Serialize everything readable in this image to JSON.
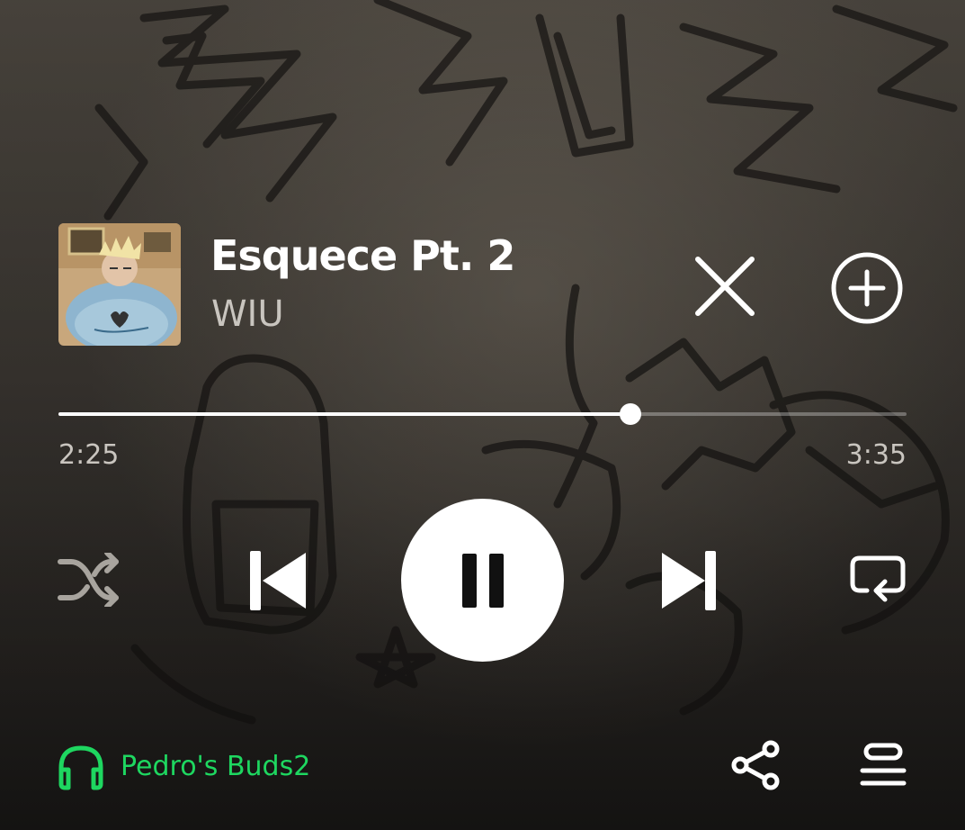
{
  "track": {
    "title": "Esquece Pt. 2",
    "artist": "WIU"
  },
  "playback": {
    "current_time": "2:25",
    "total_time": "3:35",
    "progress_fraction": 0.674,
    "is_playing": true
  },
  "device": {
    "name": "Pedro's Buds2"
  },
  "colors": {
    "accent": "#1ed760",
    "primary_text": "#ffffff",
    "secondary_text": "#c9c5bf"
  },
  "icons": {
    "close": "close-icon",
    "add": "add-circle-icon",
    "shuffle": "shuffle-icon",
    "previous": "skip-previous-icon",
    "pause": "pause-icon",
    "next": "skip-next-icon",
    "repeat": "repeat-icon",
    "device": "headphones-icon",
    "share": "share-icon",
    "queue": "queue-icon"
  }
}
